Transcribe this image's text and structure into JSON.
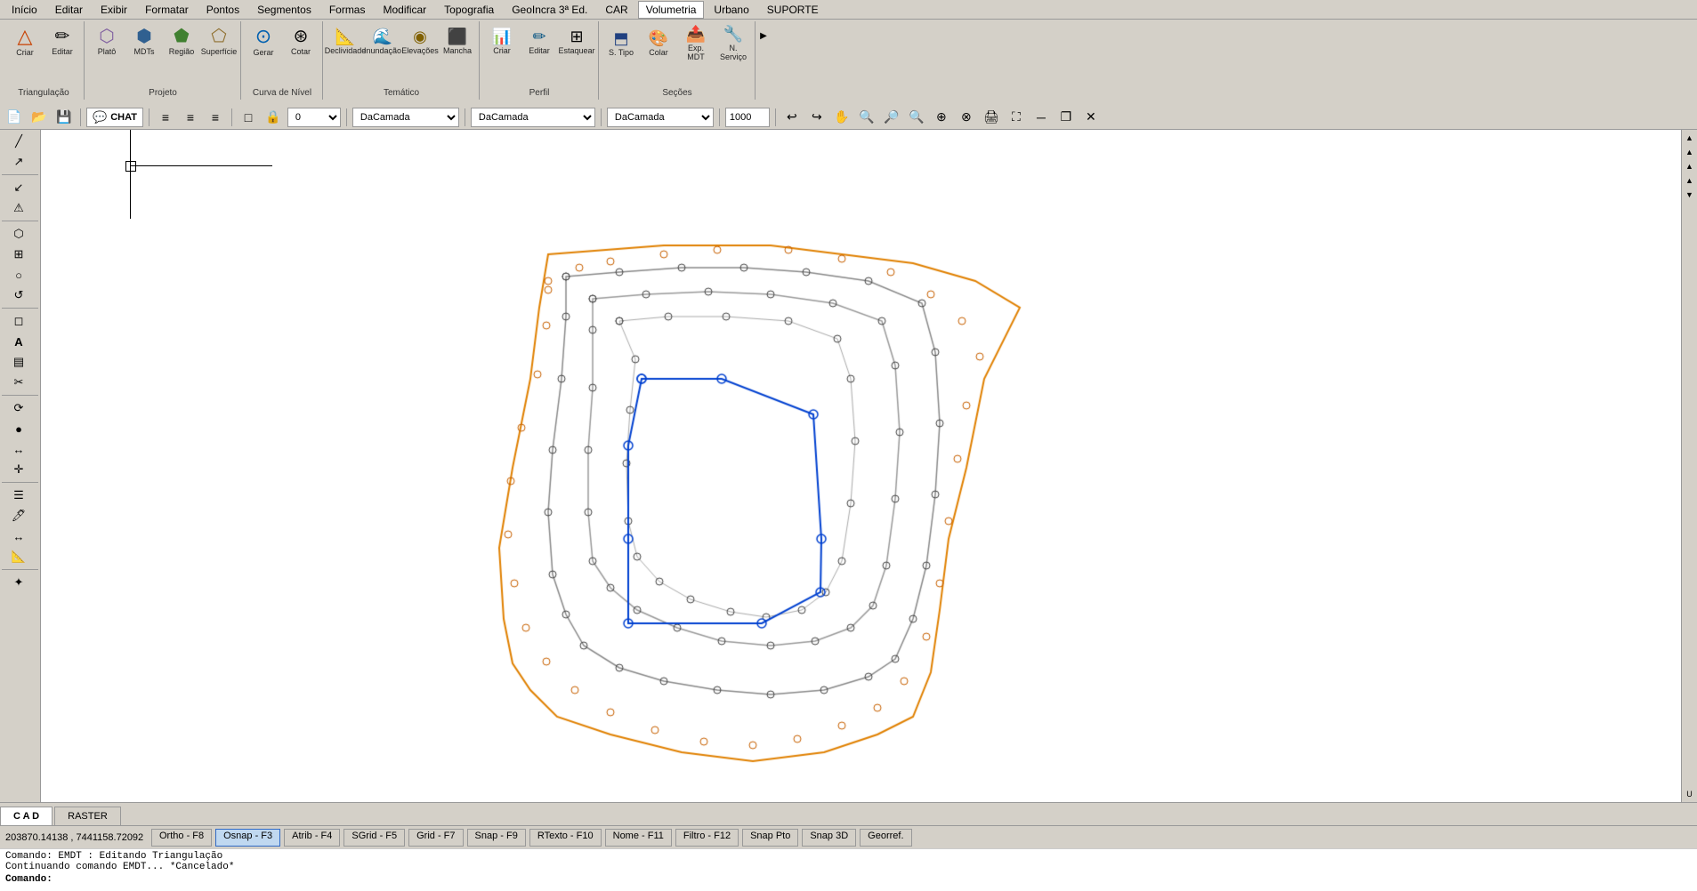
{
  "menubar": {
    "items": [
      "Início",
      "Editar",
      "Exibir",
      "Formatar",
      "Pontos",
      "Segmentos",
      "Formas",
      "Modificar",
      "Topografia",
      "GeoIncra 3ª Ed.",
      "CAR",
      "Volumetria",
      "Urbano",
      "SUPORTE"
    ]
  },
  "toolbar": {
    "groups": [
      {
        "label": "Triangulação",
        "buttons": [
          {
            "icon": "▽",
            "label": "Criar"
          },
          {
            "icon": "✎",
            "label": "Editar"
          }
        ]
      },
      {
        "label": "Projeto",
        "buttons": [
          {
            "icon": "⬡",
            "label": "Platô"
          },
          {
            "icon": "⬢",
            "label": "MDTs"
          },
          {
            "icon": "⬟",
            "label": "Região"
          },
          {
            "icon": "⬠",
            "label": "Superfície"
          }
        ]
      },
      {
        "label": "Curva de Nível",
        "buttons": [
          {
            "icon": "⊙",
            "label": "Gerar"
          },
          {
            "icon": "✂",
            "label": "Cotar"
          }
        ]
      },
      {
        "label": "Temático",
        "buttons": [
          {
            "icon": "📐",
            "label": "Declividade"
          },
          {
            "icon": "🌊",
            "label": "Inundação"
          },
          {
            "icon": "◉",
            "label": "Elevações"
          },
          {
            "icon": "⬛",
            "label": "Mancha"
          }
        ]
      },
      {
        "label": "Perfil",
        "buttons": [
          {
            "icon": "📊",
            "label": "Criar"
          },
          {
            "icon": "✏",
            "label": "Editar"
          },
          {
            "icon": "⊞",
            "label": "Estaquear"
          }
        ]
      },
      {
        "label": "Seções",
        "buttons": [
          {
            "icon": "⬒",
            "label": "S. Tipo"
          },
          {
            "icon": "🎨",
            "label": "Colar"
          },
          {
            "icon": "📤",
            "label": "Exp. MDT"
          },
          {
            "icon": "🔧",
            "label": "N. Serviço"
          }
        ]
      }
    ]
  },
  "toolbar2": {
    "chat_label": "CHAT",
    "layer_value": "0",
    "layer_placeholder": "0",
    "color_option": "DaCamada",
    "linetype_option": "DaCamada",
    "lineweight_option": "DaCamada",
    "scale_value": "1000"
  },
  "left_toolbar": {
    "tools": [
      "╱",
      "↗",
      "↙",
      "⚠",
      "⬡",
      "⊞",
      "○",
      "↺",
      "◻",
      "A",
      "▤",
      "✂",
      "⟳",
      "●",
      "↔",
      "✛",
      "☰",
      "🖊",
      "✦"
    ]
  },
  "canvas": {
    "background": "#ffffff"
  },
  "bottom_tabs": [
    {
      "label": "C A D",
      "active": true
    },
    {
      "label": "RASTER",
      "active": false
    }
  ],
  "statusbar": {
    "coords": "203870.14138 , 7441158.72092",
    "buttons": [
      {
        "label": "Ortho - F8",
        "active": false
      },
      {
        "label": "Osnap - F3",
        "active": true
      },
      {
        "label": "Atrib - F4",
        "active": false
      },
      {
        "label": "SGrid - F5",
        "active": false
      },
      {
        "label": "Grid - F7",
        "active": false
      },
      {
        "label": "Snap - F9",
        "active": false
      },
      {
        "label": "RTexto - F10",
        "active": false
      },
      {
        "label": "Nome - F11",
        "active": false
      },
      {
        "label": "Filtro - F12",
        "active": false
      },
      {
        "label": "Snap Pto",
        "active": false
      },
      {
        "label": "Snap 3D",
        "active": false
      },
      {
        "label": "Georref.",
        "active": false
      }
    ]
  },
  "command_area": {
    "line1": "Comando: EMDT : Editando Triangulação",
    "line2": "Continuando comando EMDT... *Cancelado*",
    "prompt": "Comando:"
  }
}
